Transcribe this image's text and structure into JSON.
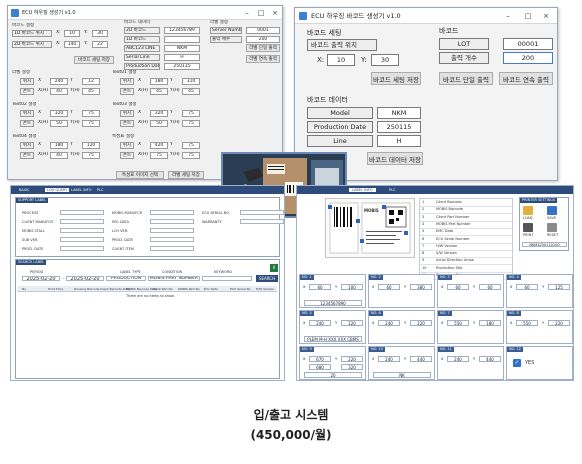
{
  "win1": {
    "title": "ECU 하우징 생성기 v1.0",
    "pos_group": "바코드 설정",
    "pos_rows": [
      {
        "label": "1D 바코드 위치",
        "x": "10",
        "y": "30"
      },
      {
        "label": "2D 바코드 위치",
        "x": "140",
        "y": "22"
      }
    ],
    "pos_button": "바코드 세팅 저장",
    "data_group": "바코드 데이터",
    "data_rows": [
      {
        "label": "2D 바코드",
        "value": "123456789"
      },
      {
        "label": "1D 바코드",
        "value": ""
      },
      {
        "label": "ABC123 LINE",
        "value": "NKM"
      },
      {
        "label": "Serial Line",
        "value": "H"
      },
      {
        "label": "Production Date",
        "value": "250115"
      }
    ],
    "label_group": "라벨 설정",
    "label_rows": [
      {
        "label": "Server Number",
        "value": "0001"
      },
      {
        "label": "출력 매수",
        "value": "200"
      }
    ],
    "label_buttons": [
      "라벨 단일 출력",
      "라벨 연속 출력"
    ],
    "sections": [
      {
        "title": "라벨 설정",
        "rows": [
          {
            "a": "위치",
            "b": "X",
            "bv": "240",
            "c": "Y",
            "cv": "12"
          },
          {
            "a": "폰트",
            "b": "X(H)",
            "bv": "40",
            "c": "Y(H)",
            "cv": "45"
          }
        ]
      },
      {
        "title": "Text01 설정",
        "rows": [
          {
            "a": "위치",
            "b": "X",
            "bv": "180",
            "c": "Y",
            "cv": "310"
          },
          {
            "a": "폰트",
            "b": "X(H)",
            "bv": "45",
            "c": "Y(H)",
            "cv": "45"
          }
        ]
      },
      {
        "title": "Text02 설정",
        "rows": [
          {
            "a": "위치",
            "b": "X",
            "bv": "320",
            "c": "Y",
            "cv": "75"
          },
          {
            "a": "폰트",
            "b": "X(H)",
            "bv": "50",
            "c": "Y(H)",
            "cv": "75"
          }
        ]
      },
      {
        "title": "Text03 설정",
        "rows": [
          {
            "a": "위치",
            "b": "X",
            "bv": "320",
            "c": "Y",
            "cv": "75"
          },
          {
            "a": "폰트",
            "b": "X(H)",
            "bv": "50",
            "c": "Y(H)",
            "cv": "75"
          }
        ]
      },
      {
        "title": "Text04 설정",
        "rows": [
          {
            "a": "위치",
            "b": "X",
            "bv": "180",
            "c": "Y",
            "cv": "120"
          },
          {
            "a": "폰트",
            "b": "X(H)",
            "bv": "40",
            "c": "Y(H)",
            "cv": "75"
          }
        ]
      },
      {
        "title": "특성표 설정",
        "rows": [
          {
            "a": "위치",
            "b": "X",
            "bv": "420",
            "c": "Y",
            "cv": "75"
          },
          {
            "a": "폰트",
            "b": "X(H)",
            "bv": "75",
            "c": "Y(H)",
            "cv": "75"
          }
        ]
      }
    ],
    "bottom_buttons": [
      "특성표 이미지 선택",
      "라벨 세팅 저장"
    ]
  },
  "win2": {
    "title": "ECU 하우징 바코드 생성기 v1.0",
    "barcode_setting": "바코드 세팅",
    "barcode_pos_label": "바코드 출력 위치",
    "x_label": "X:",
    "x_value": "10",
    "y_label": "Y:",
    "y_value": "30",
    "save_setting": "바코드 세팅 저장",
    "barcode_group": "바코드",
    "lot_label": "LOT",
    "lot_value": "00001",
    "count_label": "출력 개수",
    "count_value": "200",
    "single_print": "바코드 단일 출력",
    "continuous_print": "바코드 연속 출력",
    "data_group": "바코드 데이터",
    "model_label": "Model",
    "model_value": "NKM",
    "date_label": "Production Date",
    "date_value": "250115",
    "line_label": "Line",
    "line_value": "H",
    "save_data": "바코드 데이터 저장"
  },
  "win3": {
    "tabs": [
      "BASIC",
      "LOG QUERY",
      "LABEL INFO",
      "PLC"
    ],
    "support_label": "SUPPORT LABEL",
    "support_fields": [
      "PROCESS",
      "CLIENT MANUFCR",
      "MOBIS STALL",
      "SUB VER.",
      "PROD. DATE",
      "MOBIS MANUFCR",
      "ERC DATA",
      "LCH VER.",
      "PROD. DATE",
      "CLIENT ITEM",
      "ECU SERIAL NO.",
      "WARRANTY"
    ],
    "search_label": "SEARCH LABEL",
    "search_fields": [
      "PERIOD",
      "LABEL TYPE",
      "CONDITION",
      "KEYWORD"
    ],
    "date_from": "2025-02-20",
    "date_to": "2025-02-20",
    "type_value": "PRODUCTION",
    "cond_value": "MOBIS PART NUMBER",
    "search_button": "SEARCH",
    "columns": [
      "No",
      "Print Time",
      "Housing Barcode",
      "Client Barcode Data",
      "MOBIS Barcode Data",
      "Client Part No",
      "MOBIS Part No",
      "Eric Data",
      "ECU Serial No",
      "H/W Version"
    ],
    "empty": "There are no items to show."
  },
  "win4": {
    "tabs": [
      "LABEL INFO",
      "PLC"
    ],
    "label_text": "MOBIS",
    "table": [
      {
        "n": "1",
        "k": "Client Barcode"
      },
      {
        "n": "2",
        "k": "MOBIS Barcode"
      },
      {
        "n": "3",
        "k": "Client Part Number"
      },
      {
        "n": "4",
        "k": "MOBIS Part Number"
      },
      {
        "n": "5",
        "k": "EMC Data"
      },
      {
        "n": "6",
        "k": "ECU Serial Number"
      },
      {
        "n": "7",
        "k": "H/W Version"
      },
      {
        "n": "8",
        "k": "S/W Version"
      },
      {
        "n": "9",
        "k": "Initial Direction Arrow"
      },
      {
        "n": "10",
        "k": "Production Site"
      },
      {
        "n": "11",
        "k": "Production Date"
      }
    ],
    "printer_label": "PRINTER SETTINGS",
    "icons": [
      "LOAD",
      "SAVE",
      "PRINT",
      "RESET"
    ],
    "printer_value": "NKM4250110100",
    "panels": [
      {
        "t": "NO. 1",
        "x": "60",
        "y": "100",
        "v": "1234567890"
      },
      {
        "t": "NO. 2",
        "x": "60",
        "y": "380"
      },
      {
        "t": "NO. 3",
        "x": "60",
        "y": "60"
      },
      {
        "t": "NO. 4",
        "x": "60",
        "y": "125"
      },
      {
        "t": "NO. 5",
        "x": "240",
        "y": "120",
        "v": "PLEM M-H XXX XXX CBMS"
      },
      {
        "t": "NO. 6",
        "x": "240",
        "y": "220"
      },
      {
        "t": "NO. 7",
        "x": "550",
        "y": "180"
      },
      {
        "t": "NO. 8",
        "x": "550",
        "y": "220"
      },
      {
        "t": "NO. 9",
        "x": "670",
        "y": "220",
        "x2": "680",
        "y2": "320",
        "v": "20"
      },
      {
        "t": "NO. 10",
        "x": "240",
        "y": "440",
        "v": "NK"
      },
      {
        "t": "NO. 11",
        "x": "240",
        "y": "440"
      },
      {
        "t": "NO. 12",
        "check": "YES"
      }
    ]
  },
  "caption": {
    "line1": "입/출고 시스템",
    "line2": "(450,000/월)"
  }
}
